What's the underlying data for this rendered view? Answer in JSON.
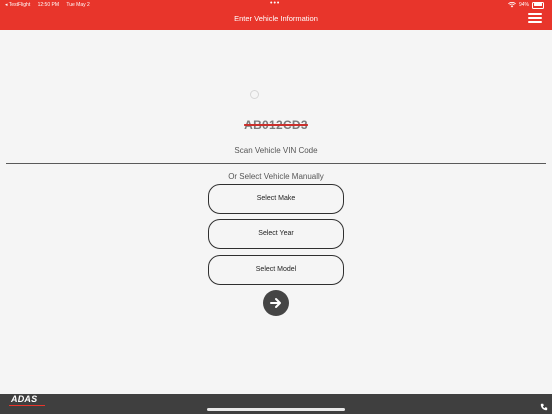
{
  "status_bar": {
    "back_app": "◂ TestFlight",
    "time": "12:50 PM",
    "date": "Tue May 2",
    "battery": "94%"
  },
  "header": {
    "title": "Enter Vehicle Information",
    "menu_icon": "hamburger-icon"
  },
  "vin": {
    "sample_code": "AB012CD3",
    "scan_label": "Scan Vehicle VIN Code"
  },
  "manual": {
    "label": "Or Select Vehicle Manually",
    "make_label": "Select Make",
    "year_label": "Select Year",
    "model_label": "Select Model",
    "next_icon": "arrow-right-icon"
  },
  "footer": {
    "logo_text": "ADAS"
  },
  "colors": {
    "brand_red": "#e8352b",
    "footer_gray": "#3f3f3f",
    "button_dark": "#454545"
  }
}
